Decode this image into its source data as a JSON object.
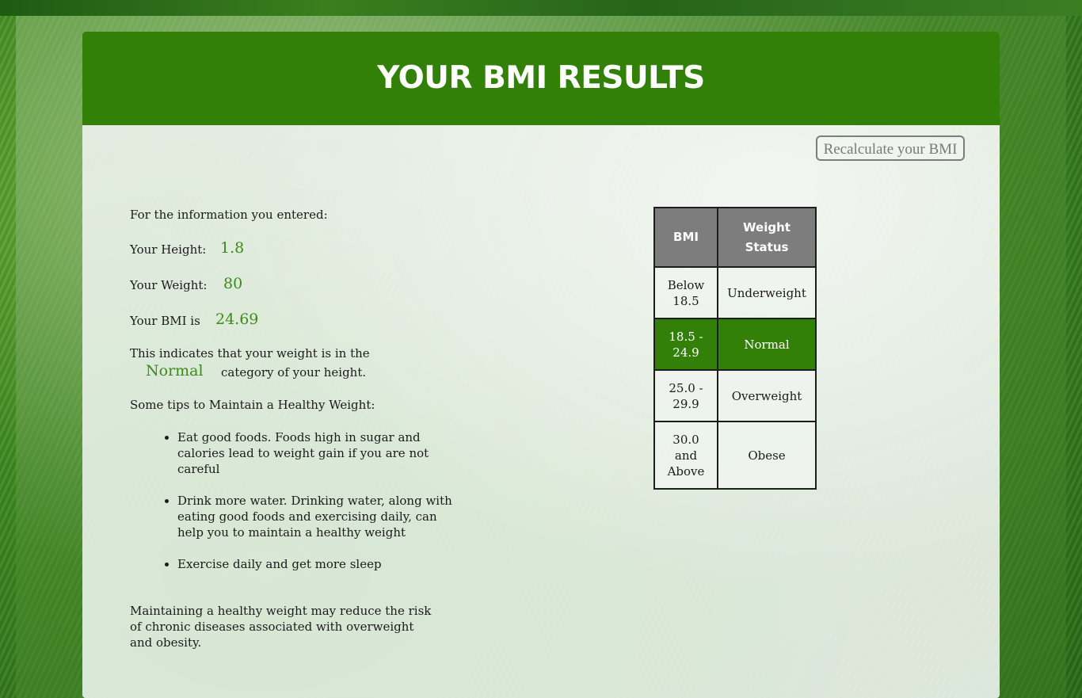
{
  "header": {
    "title": "YOUR BMI RESULTS"
  },
  "recalculate_button": {
    "label": "Recalculate your BMI"
  },
  "info": {
    "intro": "For the information you entered:",
    "height_label": "Your Height:",
    "height_value": "1.8",
    "weight_label": "Your Weight:",
    "weight_value": "80",
    "bmi_label": "Your BMI is",
    "bmi_value": "24.69",
    "indicates_text": "This indicates that your weight is in the",
    "category_value": "Normal",
    "category_suffix": "category of your height.",
    "tips_heading": "Some tips to Maintain a Healthy Weight:"
  },
  "tips": [
    "Eat good foods. Foods high in sugar and calories lead to weight gain if you are not careful",
    "Drink more water. Drinking water, along with eating good foods and exercising daily, can help you to maintain a healthy weight",
    "Exercise daily and get more sleep"
  ],
  "closing": "Maintaining a healthy weight may reduce the risk of chronic diseases associated with overweight and obesity.",
  "bmi_table": {
    "headers": [
      "BMI",
      "Weight Status"
    ],
    "rows": [
      {
        "bmi": "Below 18.5",
        "status": "Underweight"
      },
      {
        "bmi": "18.5 - 24.9",
        "status": "Normal"
      },
      {
        "bmi": "25.0 - 29.9",
        "status": "Overweight"
      },
      {
        "bmi": "30.0 and Above",
        "status": "Obese"
      }
    ]
  },
  "colors": {
    "brand_green": "#338008",
    "value_green": "#3c8a1a",
    "table_header_gray": "#7d7d7d"
  }
}
